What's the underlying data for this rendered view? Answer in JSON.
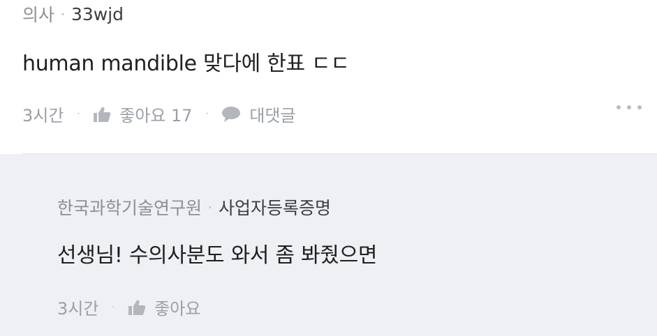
{
  "comment": {
    "author": "의사",
    "author_detail": "33wjd",
    "text": "human mandible 맞다에 한표 ㄷㄷ",
    "time": "3시간",
    "like_label": "좋아요 17",
    "reply_label": "대댓글"
  },
  "reply": {
    "author": "한국과학기술연구원",
    "author_detail": "사업자등록증명",
    "text": "선생님! 수의사분도 와서 좀 봐줬으면",
    "time": "3시간",
    "like_label": "좋아요"
  },
  "icons": {
    "like": "thumbs-up-icon",
    "reply": "speech-bubble-icon",
    "more": "more-dots-icon"
  },
  "colors": {
    "muted": "#9a9fa6",
    "reply_bg": "#eef0f3",
    "text": "#1e1f21"
  }
}
